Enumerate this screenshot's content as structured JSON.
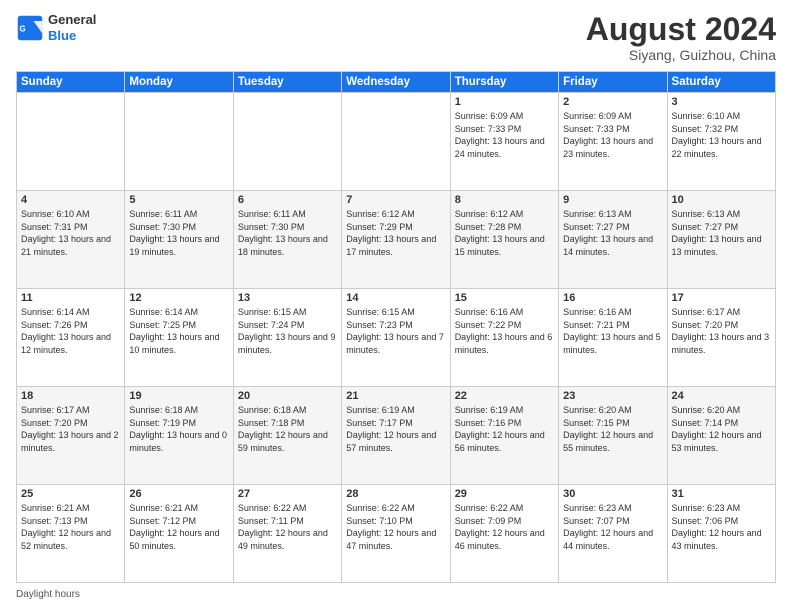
{
  "header": {
    "logo_line1": "General",
    "logo_line2": "Blue",
    "month": "August 2024",
    "location": "Siyang, Guizhou, China"
  },
  "days_of_week": [
    "Sunday",
    "Monday",
    "Tuesday",
    "Wednesday",
    "Thursday",
    "Friday",
    "Saturday"
  ],
  "weeks": [
    [
      {
        "day": "",
        "sunrise": "",
        "sunset": "",
        "daylight": ""
      },
      {
        "day": "",
        "sunrise": "",
        "sunset": "",
        "daylight": ""
      },
      {
        "day": "",
        "sunrise": "",
        "sunset": "",
        "daylight": ""
      },
      {
        "day": "",
        "sunrise": "",
        "sunset": "",
        "daylight": ""
      },
      {
        "day": "1",
        "sunrise": "Sunrise: 6:09 AM",
        "sunset": "Sunset: 7:33 PM",
        "daylight": "Daylight: 13 hours and 24 minutes."
      },
      {
        "day": "2",
        "sunrise": "Sunrise: 6:09 AM",
        "sunset": "Sunset: 7:33 PM",
        "daylight": "Daylight: 13 hours and 23 minutes."
      },
      {
        "day": "3",
        "sunrise": "Sunrise: 6:10 AM",
        "sunset": "Sunset: 7:32 PM",
        "daylight": "Daylight: 13 hours and 22 minutes."
      }
    ],
    [
      {
        "day": "4",
        "sunrise": "Sunrise: 6:10 AM",
        "sunset": "Sunset: 7:31 PM",
        "daylight": "Daylight: 13 hours and 21 minutes."
      },
      {
        "day": "5",
        "sunrise": "Sunrise: 6:11 AM",
        "sunset": "Sunset: 7:30 PM",
        "daylight": "Daylight: 13 hours and 19 minutes."
      },
      {
        "day": "6",
        "sunrise": "Sunrise: 6:11 AM",
        "sunset": "Sunset: 7:30 PM",
        "daylight": "Daylight: 13 hours and 18 minutes."
      },
      {
        "day": "7",
        "sunrise": "Sunrise: 6:12 AM",
        "sunset": "Sunset: 7:29 PM",
        "daylight": "Daylight: 13 hours and 17 minutes."
      },
      {
        "day": "8",
        "sunrise": "Sunrise: 6:12 AM",
        "sunset": "Sunset: 7:28 PM",
        "daylight": "Daylight: 13 hours and 15 minutes."
      },
      {
        "day": "9",
        "sunrise": "Sunrise: 6:13 AM",
        "sunset": "Sunset: 7:27 PM",
        "daylight": "Daylight: 13 hours and 14 minutes."
      },
      {
        "day": "10",
        "sunrise": "Sunrise: 6:13 AM",
        "sunset": "Sunset: 7:27 PM",
        "daylight": "Daylight: 13 hours and 13 minutes."
      }
    ],
    [
      {
        "day": "11",
        "sunrise": "Sunrise: 6:14 AM",
        "sunset": "Sunset: 7:26 PM",
        "daylight": "Daylight: 13 hours and 12 minutes."
      },
      {
        "day": "12",
        "sunrise": "Sunrise: 6:14 AM",
        "sunset": "Sunset: 7:25 PM",
        "daylight": "Daylight: 13 hours and 10 minutes."
      },
      {
        "day": "13",
        "sunrise": "Sunrise: 6:15 AM",
        "sunset": "Sunset: 7:24 PM",
        "daylight": "Daylight: 13 hours and 9 minutes."
      },
      {
        "day": "14",
        "sunrise": "Sunrise: 6:15 AM",
        "sunset": "Sunset: 7:23 PM",
        "daylight": "Daylight: 13 hours and 7 minutes."
      },
      {
        "day": "15",
        "sunrise": "Sunrise: 6:16 AM",
        "sunset": "Sunset: 7:22 PM",
        "daylight": "Daylight: 13 hours and 6 minutes."
      },
      {
        "day": "16",
        "sunrise": "Sunrise: 6:16 AM",
        "sunset": "Sunset: 7:21 PM",
        "daylight": "Daylight: 13 hours and 5 minutes."
      },
      {
        "day": "17",
        "sunrise": "Sunrise: 6:17 AM",
        "sunset": "Sunset: 7:20 PM",
        "daylight": "Daylight: 13 hours and 3 minutes."
      }
    ],
    [
      {
        "day": "18",
        "sunrise": "Sunrise: 6:17 AM",
        "sunset": "Sunset: 7:20 PM",
        "daylight": "Daylight: 13 hours and 2 minutes."
      },
      {
        "day": "19",
        "sunrise": "Sunrise: 6:18 AM",
        "sunset": "Sunset: 7:19 PM",
        "daylight": "Daylight: 13 hours and 0 minutes."
      },
      {
        "day": "20",
        "sunrise": "Sunrise: 6:18 AM",
        "sunset": "Sunset: 7:18 PM",
        "daylight": "Daylight: 12 hours and 59 minutes."
      },
      {
        "day": "21",
        "sunrise": "Sunrise: 6:19 AM",
        "sunset": "Sunset: 7:17 PM",
        "daylight": "Daylight: 12 hours and 57 minutes."
      },
      {
        "day": "22",
        "sunrise": "Sunrise: 6:19 AM",
        "sunset": "Sunset: 7:16 PM",
        "daylight": "Daylight: 12 hours and 56 minutes."
      },
      {
        "day": "23",
        "sunrise": "Sunrise: 6:20 AM",
        "sunset": "Sunset: 7:15 PM",
        "daylight": "Daylight: 12 hours and 55 minutes."
      },
      {
        "day": "24",
        "sunrise": "Sunrise: 6:20 AM",
        "sunset": "Sunset: 7:14 PM",
        "daylight": "Daylight: 12 hours and 53 minutes."
      }
    ],
    [
      {
        "day": "25",
        "sunrise": "Sunrise: 6:21 AM",
        "sunset": "Sunset: 7:13 PM",
        "daylight": "Daylight: 12 hours and 52 minutes."
      },
      {
        "day": "26",
        "sunrise": "Sunrise: 6:21 AM",
        "sunset": "Sunset: 7:12 PM",
        "daylight": "Daylight: 12 hours and 50 minutes."
      },
      {
        "day": "27",
        "sunrise": "Sunrise: 6:22 AM",
        "sunset": "Sunset: 7:11 PM",
        "daylight": "Daylight: 12 hours and 49 minutes."
      },
      {
        "day": "28",
        "sunrise": "Sunrise: 6:22 AM",
        "sunset": "Sunset: 7:10 PM",
        "daylight": "Daylight: 12 hours and 47 minutes."
      },
      {
        "day": "29",
        "sunrise": "Sunrise: 6:22 AM",
        "sunset": "Sunset: 7:09 PM",
        "daylight": "Daylight: 12 hours and 46 minutes."
      },
      {
        "day": "30",
        "sunrise": "Sunrise: 6:23 AM",
        "sunset": "Sunset: 7:07 PM",
        "daylight": "Daylight: 12 hours and 44 minutes."
      },
      {
        "day": "31",
        "sunrise": "Sunrise: 6:23 AM",
        "sunset": "Sunset: 7:06 PM",
        "daylight": "Daylight: 12 hours and 43 minutes."
      }
    ]
  ],
  "footer": {
    "label": "Daylight hours"
  }
}
